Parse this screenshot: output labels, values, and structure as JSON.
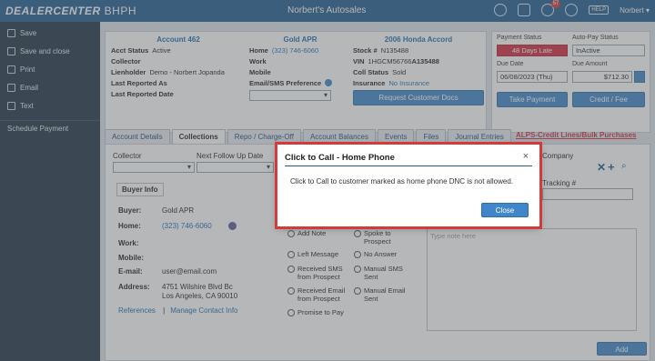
{
  "topbar": {
    "brand": "DEALERCENTER",
    "brand_sub": "BHPH",
    "dealer": "Norbert's Autosales",
    "notif_count": "57",
    "help": "HELP",
    "user": "Norbert ▾"
  },
  "sidebar": {
    "items": [
      "Save",
      "Save and close",
      "Print",
      "Email",
      "Text"
    ],
    "schedule": "Schedule Payment"
  },
  "account": {
    "title": "Account 462",
    "status_lbl": "Acct Status",
    "status": "Active",
    "collector_lbl": "Collector",
    "lienholder_lbl": "Lienholder",
    "lienholder": "Demo - Norbert Jopanda",
    "reported_as_lbl": "Last Reported As",
    "reported_date_lbl": "Last Reported Date"
  },
  "contact": {
    "title": "Gold APR",
    "home_lbl": "Home",
    "home": "(323) 746-6060",
    "work_lbl": "Work",
    "mobile_lbl": "Mobile",
    "pref_lbl": "Email/SMS Preference"
  },
  "vehicle": {
    "title": "2006 Honda Accord",
    "stock_lbl": "Stock #",
    "stock": "N135488",
    "vin_lbl": "VIN",
    "vin_a": "1HGCM56766",
    "vin_b": "A135488",
    "coll_lbl": "Coll Status",
    "coll": "Sold",
    "ins_lbl": "Insurance",
    "ins": "No Insurance",
    "docs_btn": "Request Customer Docs"
  },
  "status": {
    "pay_lbl": "Payment Status",
    "pay": "48 Days Late",
    "auto_lbl": "Auto-Pay Status",
    "auto": "InActive",
    "due_date_lbl": "Due Date",
    "due_date": "06/08/2023 (Thu)",
    "due_amt_lbl": "Due Amount",
    "due_amt": "$712.30",
    "take_btn": "Take Payment",
    "credit_btn": "Credit / Fee"
  },
  "tabs": [
    "Account Details",
    "Collections",
    "Repo / Charge-Off",
    "Account Balances",
    "Events",
    "Files",
    "Journal Entries"
  ],
  "alps": "ALPS-Credit Lines/Bulk Purchases",
  "collections": {
    "collector_lbl": "Collector",
    "followup_lbl": "Next Follow Up Date",
    "company_lbl": "Company",
    "tracking_lbl": "Tracking #"
  },
  "buyer": {
    "tab": "Buyer Info",
    "buyer_lbl": "Buyer:",
    "buyer": "Gold APR",
    "home_lbl": "Home:",
    "home": "(323) 746-6060",
    "work_lbl": "Work:",
    "mobile_lbl": "Mobile:",
    "email_lbl": "E-mail:",
    "email": "user@email.com",
    "address_lbl": "Address:",
    "addr1": "4751 Wilshire Blvd Bc",
    "addr2": "Los Angeles, CA 90010",
    "refs": "References",
    "sep": "|",
    "manage": "Manage Contact Info"
  },
  "radios": [
    "Add Note",
    "Spoke to Prospect",
    "Left Message",
    "No Answer",
    "Received SMS from Prospect",
    "Manual SMS Sent",
    "Received Email from Prospect",
    "Manual Email Sent",
    "Promise to Pay"
  ],
  "note_placeholder": "Type note here",
  "add_btn": "Add",
  "modal": {
    "title": "Click to Call - Home Phone",
    "close": "×",
    "message": "Click to Call to customer marked as home phone DNC is not allowed.",
    "button": "Close"
  }
}
